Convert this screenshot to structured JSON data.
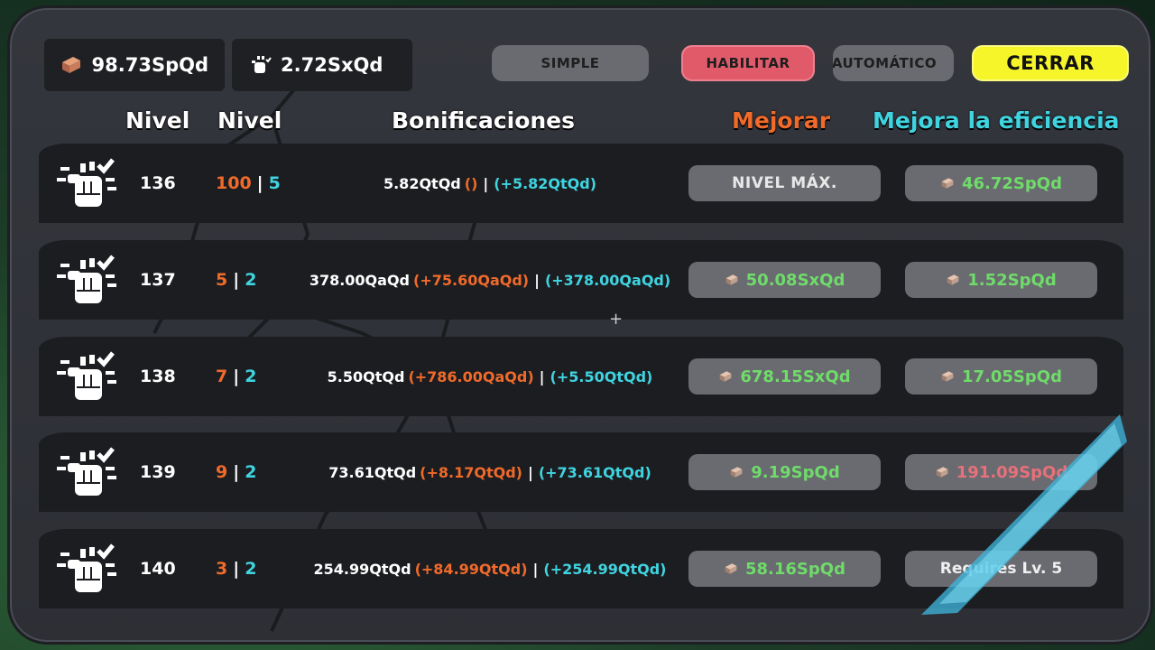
{
  "resources": {
    "bricks": {
      "icon": "brick-icon",
      "value": "98.73SpQd"
    },
    "fists": {
      "icon": "fist-icon",
      "value": "2.72SxQd"
    }
  },
  "toolbar": {
    "simple_label": "SIMPLE",
    "enable_label": "HABILITAR",
    "auto_label": "AUTOMÁTICO",
    "close_label": "CERRAR"
  },
  "headers": {
    "level": "Nivel",
    "level2": "Nivel",
    "bonuses": "Bonificaciones",
    "upgrade": "Mejorar",
    "efficiency": "Mejora la eficiencia"
  },
  "rows": [
    {
      "level": "136",
      "lvl_a": "100",
      "lvl_b": "5",
      "bonus_base": "5.82QtQd",
      "bonus_add": "()",
      "bonus_total": "(+5.82QtQd)",
      "upgrade": "NIVEL MÁX.",
      "efficiency": "46.72SpQd"
    },
    {
      "level": "137",
      "lvl_a": "5",
      "lvl_b": "2",
      "bonus_base": "378.00QaQd",
      "bonus_add": "(+75.60QaQd)",
      "bonus_total": "(+378.00QaQd)",
      "upgrade": "50.08SxQd",
      "efficiency": "1.52SpQd"
    },
    {
      "level": "138",
      "lvl_a": "7",
      "lvl_b": "2",
      "bonus_base": "5.50QtQd",
      "bonus_add": "(+786.00QaQd)",
      "bonus_total": "(+5.50QtQd)",
      "upgrade": "678.15SxQd",
      "efficiency": "17.05SpQd"
    },
    {
      "level": "139",
      "lvl_a": "9",
      "lvl_b": "2",
      "bonus_base": "73.61QtQd",
      "bonus_add": "(+8.17QtQd)",
      "bonus_total": "(+73.61QtQd)",
      "upgrade": "9.19SpQd",
      "efficiency": "191.09SpQd"
    },
    {
      "level": "140",
      "lvl_a": "3",
      "lvl_b": "2",
      "bonus_base": "254.99QtQd",
      "bonus_add": "(+84.99QtQd)",
      "bonus_total": "(+254.99QtQd)",
      "upgrade": "58.16SpQd",
      "efficiency": "Requires Lv. 5"
    }
  ],
  "separator": "|",
  "colors": {
    "orange": "#f06a2a",
    "cyan": "#3fd4e0",
    "green_price": "#6fdc6a",
    "red_price": "#e8707a",
    "close_button": "#f5f52a",
    "enable_button": "#e05a6a"
  }
}
